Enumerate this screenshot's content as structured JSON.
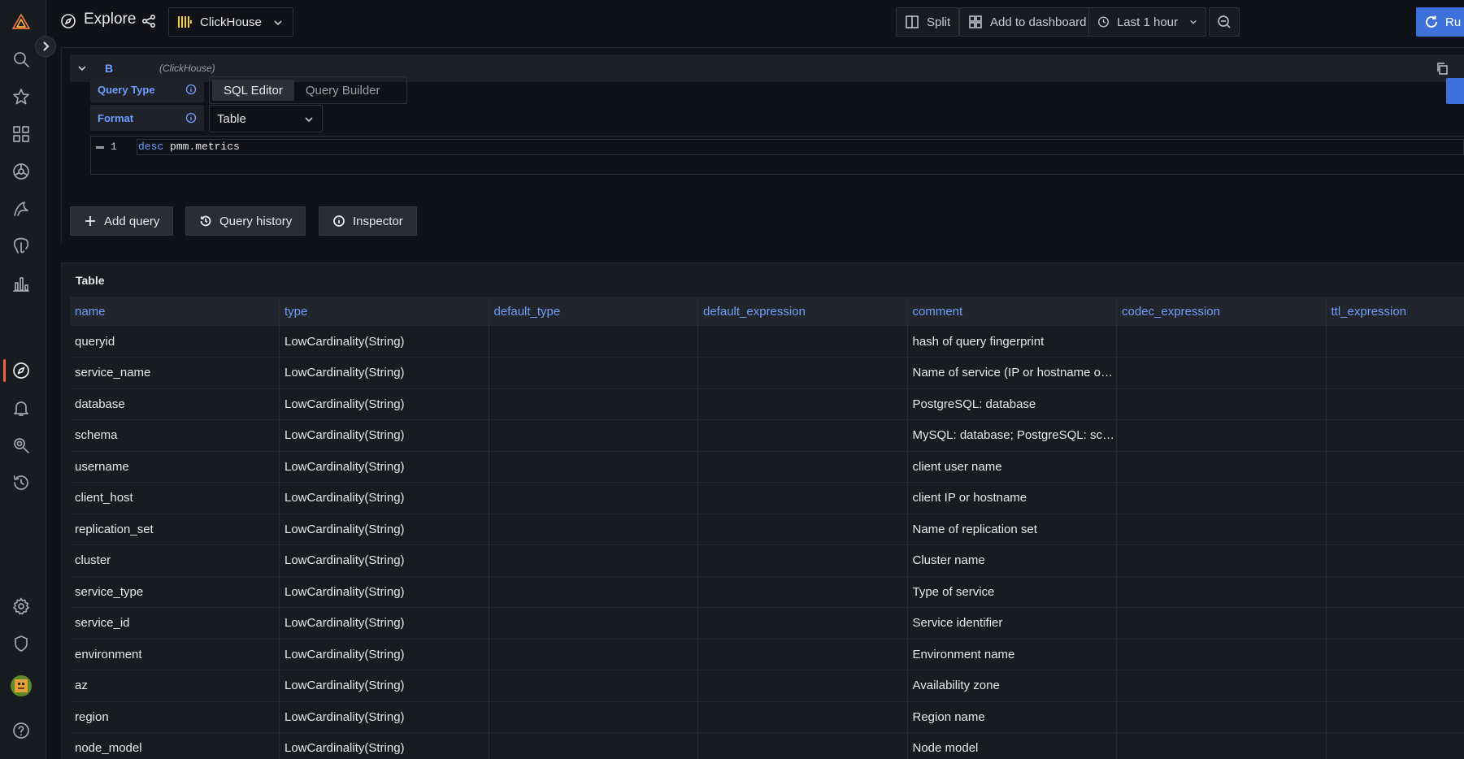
{
  "app": {
    "title": "Explore",
    "datasource": "ClickHouse"
  },
  "toolbar": {
    "split_label": "Split",
    "add_dashboard_label": "Add to dashboard",
    "time_range_label": "Last 1 hour",
    "run_label": "Ru"
  },
  "query": {
    "ref_id": "B",
    "datasource_hint": "(ClickHouse)",
    "query_type_label": "Query Type",
    "query_type_options": [
      "SQL Editor",
      "Query Builder"
    ],
    "format_label": "Format",
    "format_value": "Table",
    "line_number": "1",
    "code_keyword": "desc",
    "code_rest": " pmm.metrics"
  },
  "actions": {
    "add_query": "Add query",
    "query_history": "Query history",
    "inspector": "Inspector"
  },
  "table": {
    "title": "Table",
    "columns": [
      "name",
      "type",
      "default_type",
      "default_expression",
      "comment",
      "codec_expression",
      "ttl_expression"
    ],
    "rows": [
      [
        "queryid",
        "LowCardinality(String)",
        "",
        "",
        "hash of query fingerprint",
        "",
        ""
      ],
      [
        "service_name",
        "LowCardinality(String)",
        "",
        "",
        "Name of service (IP or hostname of DB instance)",
        "",
        ""
      ],
      [
        "database",
        "LowCardinality(String)",
        "",
        "",
        "PostgreSQL: database",
        "",
        ""
      ],
      [
        "schema",
        "LowCardinality(String)",
        "",
        "",
        "MySQL: database; PostgreSQL: schema",
        "",
        ""
      ],
      [
        "username",
        "LowCardinality(String)",
        "",
        "",
        "client user name",
        "",
        ""
      ],
      [
        "client_host",
        "LowCardinality(String)",
        "",
        "",
        "client IP or hostname",
        "",
        ""
      ],
      [
        "replication_set",
        "LowCardinality(String)",
        "",
        "",
        "Name of replication set",
        "",
        ""
      ],
      [
        "cluster",
        "LowCardinality(String)",
        "",
        "",
        "Cluster name",
        "",
        ""
      ],
      [
        "service_type",
        "LowCardinality(String)",
        "",
        "",
        "Type of service",
        "",
        ""
      ],
      [
        "service_id",
        "LowCardinality(String)",
        "",
        "",
        "Service identifier",
        "",
        ""
      ],
      [
        "environment",
        "LowCardinality(String)",
        "",
        "",
        "Environment name",
        "",
        ""
      ],
      [
        "az",
        "LowCardinality(String)",
        "",
        "",
        "Availability zone",
        "",
        ""
      ],
      [
        "region",
        "LowCardinality(String)",
        "",
        "",
        "Region name",
        "",
        ""
      ],
      [
        "node_model",
        "LowCardinality(String)",
        "",
        "",
        "Node model",
        "",
        ""
      ]
    ]
  },
  "colors": {
    "background": "#111217",
    "panel": "#181b1f",
    "accent_blue": "#6e9fff",
    "run_button": "#3d71d9",
    "active_indicator": "#f55f3e"
  },
  "sidebar_icons": [
    "grafana-logo-icon",
    "search-icon",
    "star-icon",
    "dashboards-icon",
    "pmm-dashboard-icon",
    "mysql-icon",
    "postgresql-icon",
    "bar-chart-icon",
    "explore-compass-icon",
    "alerting-bell-icon",
    "query-analytics-icon",
    "history-icon",
    "settings-gear-icon",
    "shield-icon",
    "user-avatar",
    "help-icon"
  ]
}
